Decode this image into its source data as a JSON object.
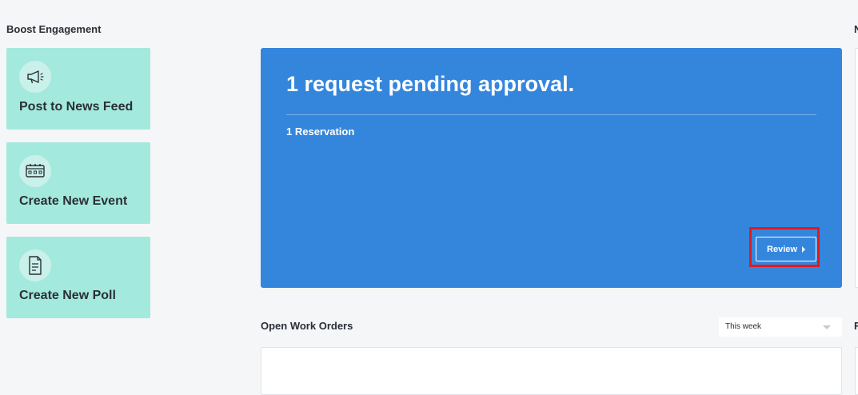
{
  "boost": {
    "title": "Boost Engagement",
    "actions": [
      {
        "label": "Post to News Feed",
        "icon": "megaphone-icon"
      },
      {
        "label": "Create New Event",
        "icon": "calendar-icon"
      },
      {
        "label": "Create New Poll",
        "icon": "document-icon"
      }
    ]
  },
  "approval": {
    "title": "1 request pending approval.",
    "subtitle": "1 Reservation",
    "review_label": "Review"
  },
  "work_orders": {
    "title": "Open Work Orders",
    "period": "This week"
  },
  "right_column": {
    "title_top": "N",
    "title_bottom": "R"
  },
  "colors": {
    "accent_blue": "#3486dc",
    "mint": "#a4e9dd",
    "highlight_red": "#e3191c"
  }
}
